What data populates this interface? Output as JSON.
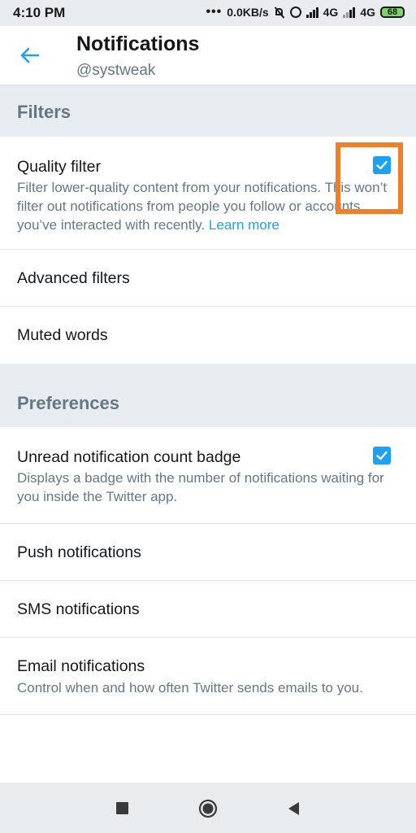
{
  "status_bar": {
    "time": "4:10 PM",
    "dots": "•••",
    "network_speed": "0.0KB/s",
    "net1": "4G",
    "net2": "4G",
    "battery": "68",
    "icons": [
      "mute-icon",
      "alarm-icon",
      "signal-icon",
      "signal-icon",
      "battery-icon"
    ]
  },
  "header": {
    "title": "Notifications",
    "subtitle": "@systweak",
    "back_icon": "arrow-left-icon"
  },
  "filters": {
    "heading": "Filters",
    "quality_filter": {
      "label": "Quality filter",
      "description": "Filter lower-quality content from your notifications. This won’t filter out notifications from people you follow or accounts you’ve interacted with recently.",
      "link": "Learn more",
      "checked": true
    },
    "advanced_filters": "Advanced filters",
    "muted_words": "Muted words"
  },
  "preferences": {
    "heading": "Preferences",
    "unread_badge": {
      "label": "Unread notification count badge",
      "description": "Displays a badge with the number of notifications waiting for you inside the Twitter app.",
      "checked": true
    },
    "push": "Push notifications",
    "sms": "SMS notifications",
    "email": {
      "label": "Email notifications",
      "description": "Control when and how often Twitter sends emails to you."
    }
  },
  "colors": {
    "accent": "#1da1f2",
    "highlight": "#f07f2a",
    "section_bg": "#e6ecf0"
  },
  "nav_bar": {
    "icons": [
      "recents-square-icon",
      "home-circle-icon",
      "back-triangle-icon"
    ]
  }
}
